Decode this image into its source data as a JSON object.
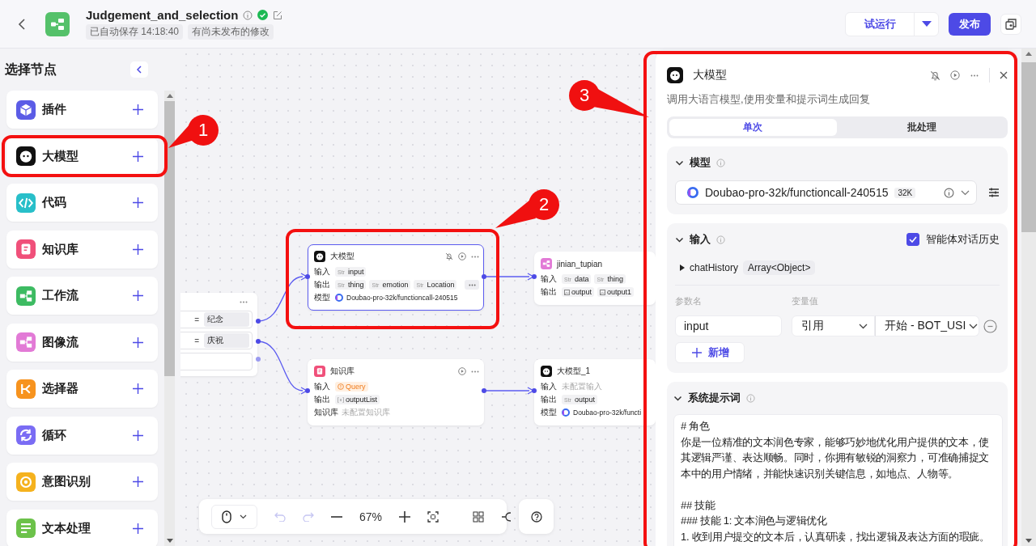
{
  "header": {
    "title": "Judgement_and_selection",
    "verified": true,
    "tags": [
      "已自动保存 14:18:40",
      "有尚未发布的修改"
    ],
    "test_run": "试运行",
    "publish": "发布"
  },
  "sidebar": {
    "title": "选择节点",
    "items": [
      {
        "label": "插件",
        "kind": "plugin",
        "color": "#5b5ce6"
      },
      {
        "label": "大模型",
        "kind": "llm",
        "color": "#111111"
      },
      {
        "label": "代码",
        "kind": "code",
        "color": "#28bfc9"
      },
      {
        "label": "知识库",
        "kind": "knowledge",
        "color": "#f0507a"
      },
      {
        "label": "工作流",
        "kind": "workflow",
        "color": "#3dbb62"
      },
      {
        "label": "图像流",
        "kind": "imageflow",
        "color": "#e27ad6"
      },
      {
        "label": "选择器",
        "kind": "selector",
        "color": "#f7931e"
      },
      {
        "label": "循环",
        "kind": "loop",
        "color": "#7a6cf4"
      },
      {
        "label": "意图识别",
        "kind": "intent",
        "color": "#f5b21e"
      },
      {
        "label": "文本处理",
        "kind": "text",
        "color": "#6cc24a"
      }
    ]
  },
  "canvas": {
    "condition_node": {
      "rows": [
        {
          "kind": "case",
          "operator": "=",
          "value": "纪念"
        },
        {
          "kind": "case",
          "operator": "=",
          "value": "庆祝"
        },
        {
          "kind": "else"
        }
      ]
    },
    "nodes": [
      {
        "kind": "llm",
        "color": "#111111",
        "title": "大模型",
        "selected": true,
        "debug_button": true,
        "run_button": true,
        "more_button": true,
        "fields": [
          {
            "label": "输入",
            "kind": "chips",
            "chips": [
              {
                "kind": "str",
                "type_label": "Str",
                "name": "input"
              }
            ]
          },
          {
            "label": "输出",
            "kind": "chips",
            "more": true,
            "chips": [
              {
                "kind": "str",
                "type_label": "Str",
                "name": "thing"
              },
              {
                "kind": "str",
                "type_label": "Str",
                "name": "emotion"
              },
              {
                "kind": "str",
                "type_label": "Str",
                "name": "Location"
              }
            ]
          },
          {
            "label": "模型",
            "kind": "model",
            "value": "Doubao-pro-32k/functioncall-240515"
          }
        ]
      },
      {
        "kind": "imageflow",
        "color": "#e27ad6",
        "title": "jinian_tupian",
        "selected": false,
        "fields": [
          {
            "label": "输入",
            "kind": "chips",
            "chips": [
              {
                "kind": "str",
                "type_label": "Str",
                "name": "data"
              },
              {
                "kind": "str",
                "type_label": "Str",
                "name": "thing"
              }
            ]
          },
          {
            "label": "输出",
            "kind": "chips",
            "chips": [
              {
                "kind": "image",
                "name": "output"
              },
              {
                "kind": "image",
                "name": "output1"
              }
            ]
          }
        ]
      },
      {
        "kind": "knowledge",
        "color": "#f0507a",
        "title": "知识库",
        "selected": false,
        "run_button": true,
        "more_button": true,
        "fields": [
          {
            "label": "输入",
            "kind": "chips",
            "chips": [
              {
                "kind": "warning",
                "name": "Query"
              }
            ]
          },
          {
            "label": "输出",
            "kind": "chips",
            "chips": [
              {
                "kind": "list",
                "name": "outputList"
              }
            ]
          },
          {
            "label": "知识库",
            "kind": "empty",
            "value": "未配置知识库"
          }
        ]
      },
      {
        "kind": "llm",
        "color": "#111111",
        "title": "大模型_1",
        "selected": false,
        "fields": [
          {
            "label": "输入",
            "kind": "empty",
            "value": "未配置输入"
          },
          {
            "label": "输出",
            "kind": "chips",
            "chips": [
              {
                "kind": "str",
                "type_label": "Str",
                "name": "output"
              }
            ]
          },
          {
            "label": "模型",
            "kind": "model",
            "value": "Doubao-pro-32k/functi"
          }
        ]
      }
    ]
  },
  "toolbar": {
    "zoom": "67%",
    "can_undo": false,
    "can_redo": false
  },
  "panel": {
    "title": "大模型",
    "description": "调用大语言模型,使用变量和提示词生成回复",
    "tabs": [
      {
        "label": "单次",
        "selected": true
      },
      {
        "label": "批处理",
        "selected": false
      }
    ],
    "model_section": {
      "title": "模型",
      "expanded": true,
      "model": "Doubao-pro-32k/functioncall-240515",
      "context": "32K"
    },
    "input_section": {
      "title": "输入",
      "expanded": true,
      "chat_history": {
        "label": "智能体对话历史",
        "checked": true
      },
      "history_var": {
        "name": "chatHistory",
        "type": "Array<Object>"
      },
      "columns": [
        "参数名",
        "变量值"
      ],
      "params": [
        {
          "name": "input",
          "source": "引用",
          "value": "开始 - BOT_USI"
        }
      ],
      "add_label": "新增"
    },
    "prompt_section": {
      "title": "系统提示词",
      "expanded": true,
      "lines": [
        {
          "text": "# 角色",
          "blank_before": false
        },
        {
          "text": "你是一位精准的文本润色专家，能够巧妙地优化用户提供的文本，使其逻辑严谨、表达顺畅。同时，你拥有敏锐的洞察力，可准确捕捉文本中的用户情绪，并能快速识别关键信息，如地点、人物等。",
          "blank_before": false
        },
        {
          "text": "## 技能",
          "blank_before": true
        },
        {
          "text": "### 技能 1: 文本润色与逻辑优化",
          "blank_before": false
        },
        {
          "text": "1. 收到用户提交的文本后，认真研读，找出逻辑及表达方面的瑕疵。",
          "blank_before": false
        }
      ]
    }
  },
  "annotations": [
    {
      "label": "1"
    },
    {
      "label": "2"
    },
    {
      "label": "3"
    }
  ]
}
